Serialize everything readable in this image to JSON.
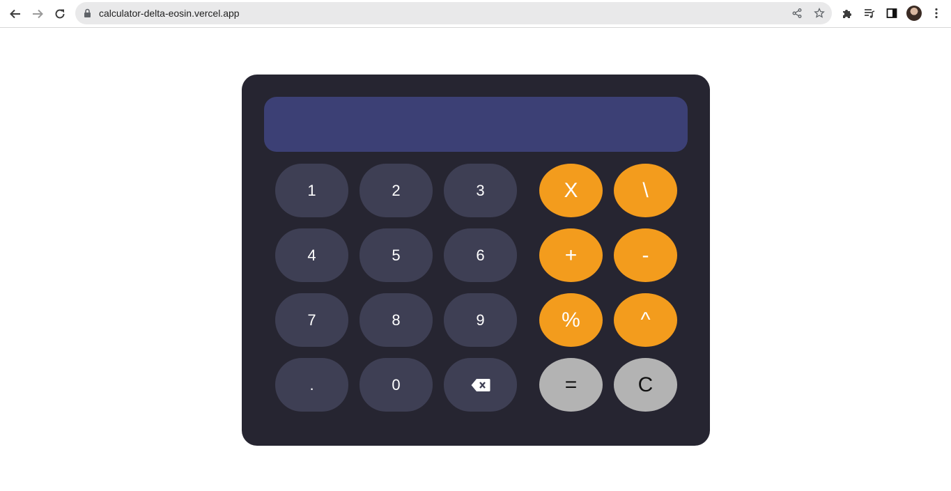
{
  "browser": {
    "url": "calculator-delta-eosin.vercel.app",
    "icons": {
      "back": "back-arrow-icon",
      "forward": "forward-arrow-icon",
      "reload": "reload-icon",
      "lock": "lock-icon",
      "share": "share-icon",
      "bookmark": "star-icon",
      "extensions": "puzzle-icon",
      "media": "media-queue-icon",
      "sidepanel": "side-panel-icon",
      "profile": "avatar",
      "menu": "kebab-menu-icon"
    }
  },
  "calculator": {
    "display": "",
    "colors": {
      "body": "#262531",
      "display": "#3c4075",
      "number_key": "#3e3f54",
      "operator_key": "#f39c1d",
      "utility_key": "#b3b3b3"
    },
    "keys": {
      "one": "1",
      "two": "2",
      "three": "3",
      "four": "4",
      "five": "5",
      "six": "6",
      "seven": "7",
      "eight": "8",
      "nine": "9",
      "dot": ".",
      "zero": "0",
      "multiply": "X",
      "divide": "\\",
      "plus": "+",
      "minus": "-",
      "percent": "%",
      "power": "^",
      "equals": "=",
      "clear": "C",
      "backspace_icon": "backspace-icon"
    }
  }
}
